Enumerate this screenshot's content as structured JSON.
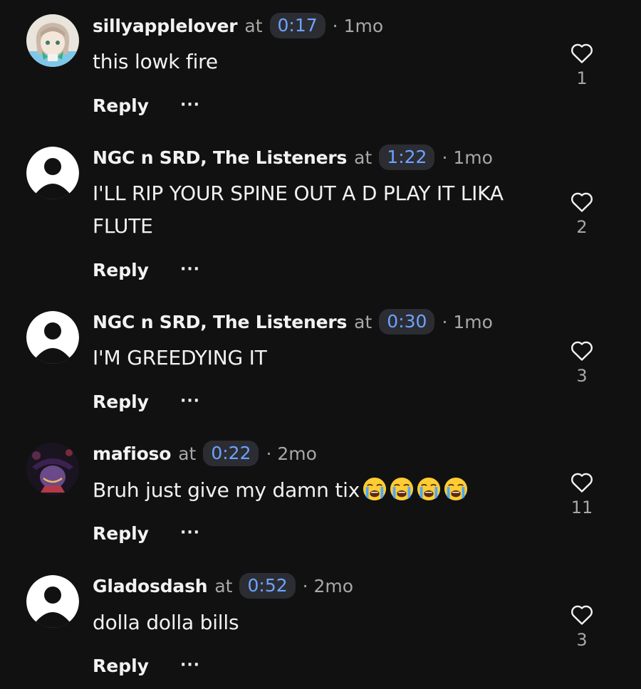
{
  "comments": [
    {
      "username": "sillyapplelover",
      "at": "at",
      "timestamp": "0:17",
      "ago": "· 1mo",
      "text": "this lowk fire",
      "reply_label": "Reply",
      "more_label": "···",
      "likes": "1",
      "avatar": "anime-avatar"
    },
    {
      "username": "NGC n SRD, The Listeners",
      "at": "at",
      "timestamp": "1:22",
      "ago": "· 1mo",
      "text": "I'LL RIP YOUR SPINE OUT A D PLAY IT LIKA FLUTE",
      "reply_label": "Reply",
      "more_label": "···",
      "likes": "2",
      "avatar": "default-avatar"
    },
    {
      "username": "NGC n SRD, The Listeners",
      "at": "at",
      "timestamp": "0:30",
      "ago": "· 1mo",
      "text": "I'M GREEDYING IT",
      "reply_label": "Reply",
      "more_label": "···",
      "likes": "3",
      "avatar": "default-avatar"
    },
    {
      "username": "mafioso",
      "at": "at",
      "timestamp": "0:22",
      "ago": "· 2mo",
      "text": "Bruh just give my damn tix",
      "emojis": [
        "loudly-crying-face",
        "loudly-crying-face",
        "loudly-crying-face",
        "loudly-crying-face"
      ],
      "reply_label": "Reply",
      "more_label": "···",
      "likes": "11",
      "avatar": "character-avatar"
    },
    {
      "username": "Gladosdash",
      "at": "at",
      "timestamp": "0:52",
      "ago": "· 2mo",
      "text": "dolla dolla bills",
      "reply_label": "Reply",
      "more_label": "···",
      "likes": "3",
      "avatar": "default-avatar"
    }
  ],
  "colors": {
    "background": "#111111",
    "timestamp_text": "#6ea2ff",
    "timestamp_bg": "#2b2d33",
    "muted_text": "#a8a8a8",
    "primary_text": "#f2f2f2"
  }
}
